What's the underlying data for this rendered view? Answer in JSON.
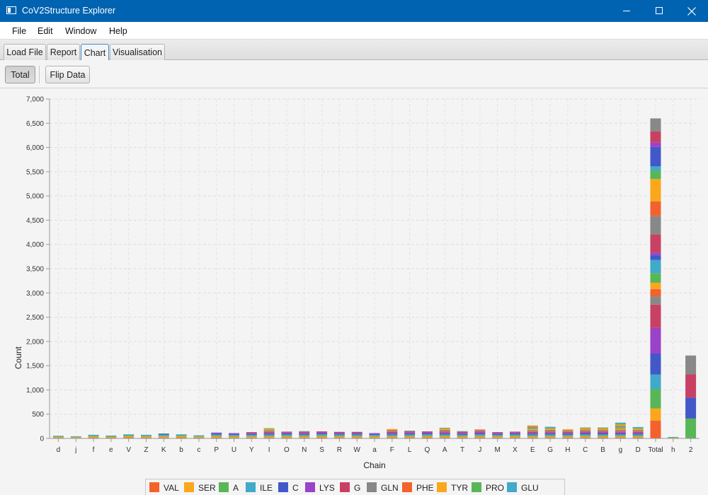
{
  "window": {
    "title": "CoV2Structure Explorer",
    "minimize_icon": "minimize-icon",
    "maximize_icon": "maximize-icon",
    "close_icon": "close-icon"
  },
  "menu": [
    "File",
    "Edit",
    "Window",
    "Help"
  ],
  "tabs": [
    {
      "label": "Load File",
      "active": false
    },
    {
      "label": "Report",
      "active": false
    },
    {
      "label": "Chart",
      "active": true
    },
    {
      "label": "Visualisation",
      "active": false
    }
  ],
  "toolbar": {
    "total_label": "Total",
    "flip_label": "Flip Data"
  },
  "chart_data": {
    "type": "bar",
    "stacked": true,
    "xlabel": "Chain",
    "ylabel": "Count",
    "ylim": [
      0,
      7000
    ],
    "yticks": [
      0,
      500,
      1000,
      1500,
      2000,
      2500,
      3000,
      3500,
      4000,
      4500,
      5000,
      5500,
      6000,
      6500,
      7000
    ],
    "ytick_labels": [
      "0",
      "500",
      "1,000",
      "1,500",
      "2,000",
      "2,500",
      "3,000",
      "3,500",
      "4,000",
      "4,500",
      "5,000",
      "5,500",
      "6,000",
      "6,500",
      "7,000"
    ],
    "grid": true,
    "legend_position": "bottom",
    "categories": [
      "d",
      "j",
      "f",
      "e",
      "V",
      "Z",
      "K",
      "b",
      "c",
      "P",
      "U",
      "Y",
      "I",
      "O",
      "N",
      "S",
      "R",
      "W",
      "a",
      "F",
      "L",
      "Q",
      "A",
      "T",
      "J",
      "M",
      "X",
      "E",
      "G",
      "H",
      "C",
      "B",
      "g",
      "D",
      "Total",
      "h",
      "2"
    ],
    "totals": [
      55,
      45,
      75,
      60,
      85,
      75,
      100,
      85,
      65,
      120,
      110,
      130,
      210,
      140,
      150,
      145,
      135,
      135,
      110,
      195,
      160,
      145,
      220,
      150,
      185,
      130,
      140,
      270,
      240,
      190,
      225,
      225,
      325,
      235,
      6630,
      30,
      1710
    ],
    "series": [
      {
        "name": "VAL",
        "color": "#f3622d"
      },
      {
        "name": "SER",
        "color": "#fba71b"
      },
      {
        "name": "A",
        "color": "#57b757"
      },
      {
        "name": "ILE",
        "color": "#41a9c9"
      },
      {
        "name": "C",
        "color": "#4258c9"
      },
      {
        "name": "LYS",
        "color": "#9a42c8"
      },
      {
        "name": "G",
        "color": "#c84164"
      },
      {
        "name": "GLN",
        "color": "#888888"
      },
      {
        "name": "PHE",
        "color": "#f3622d"
      },
      {
        "name": "TYR",
        "color": "#fba71b"
      },
      {
        "name": "PRO",
        "color": "#57b757"
      },
      {
        "name": "GLU",
        "color": "#41a9c9"
      }
    ],
    "total_bar_segments": [
      {
        "color": "#f3622d",
        "value": 370
      },
      {
        "color": "#fba71b",
        "value": 250
      },
      {
        "color": "#57b757",
        "value": 400
      },
      {
        "color": "#41a9c9",
        "value": 300
      },
      {
        "color": "#4258c9",
        "value": 430
      },
      {
        "color": "#9a42c8",
        "value": 530
      },
      {
        "color": "#c84164",
        "value": 480
      },
      {
        "color": "#888888",
        "value": 170
      },
      {
        "color": "#f3622d",
        "value": 150
      },
      {
        "color": "#fba71b",
        "value": 130
      },
      {
        "color": "#57b757",
        "value": 200
      },
      {
        "color": "#41a9c9",
        "value": 270
      },
      {
        "color": "#4258c9",
        "value": 100
      },
      {
        "color": "#9a42c8",
        "value": 50
      },
      {
        "color": "#c84164",
        "value": 380
      },
      {
        "color": "#888888",
        "value": 380
      },
      {
        "color": "#f3622d",
        "value": 300
      },
      {
        "color": "#fba71b",
        "value": 460
      },
      {
        "color": "#57b757",
        "value": 170
      },
      {
        "color": "#41a9c9",
        "value": 90
      },
      {
        "color": "#4258c9",
        "value": 400
      },
      {
        "color": "#9a42c8",
        "value": 90
      },
      {
        "color": "#c84164",
        "value": 230
      },
      {
        "color": "#888888",
        "value": 270
      }
    ],
    "chain2_segments": [
      {
        "color": "#57b757",
        "value": 410
      },
      {
        "color": "#4258c9",
        "value": 430
      },
      {
        "color": "#c84164",
        "value": 480
      },
      {
        "color": "#888888",
        "value": 390
      }
    ]
  }
}
